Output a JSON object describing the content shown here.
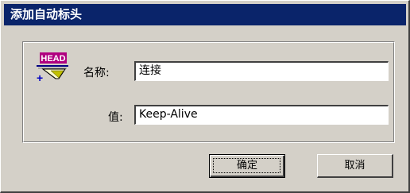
{
  "dialog": {
    "title": "添加自动标头"
  },
  "icon": {
    "name": "head-header-icon",
    "badge_text": "HEAD",
    "plus_symbol": "+"
  },
  "form": {
    "name_label": "名称:",
    "name_value": "连接",
    "value_label": "值:",
    "value_value": "Keep-Alive"
  },
  "buttons": {
    "ok_label": "确定",
    "cancel_label": "取消"
  },
  "colors": {
    "titlebar": "#0a246a",
    "face": "#d4d0c8",
    "head_badge": "#b00080"
  }
}
